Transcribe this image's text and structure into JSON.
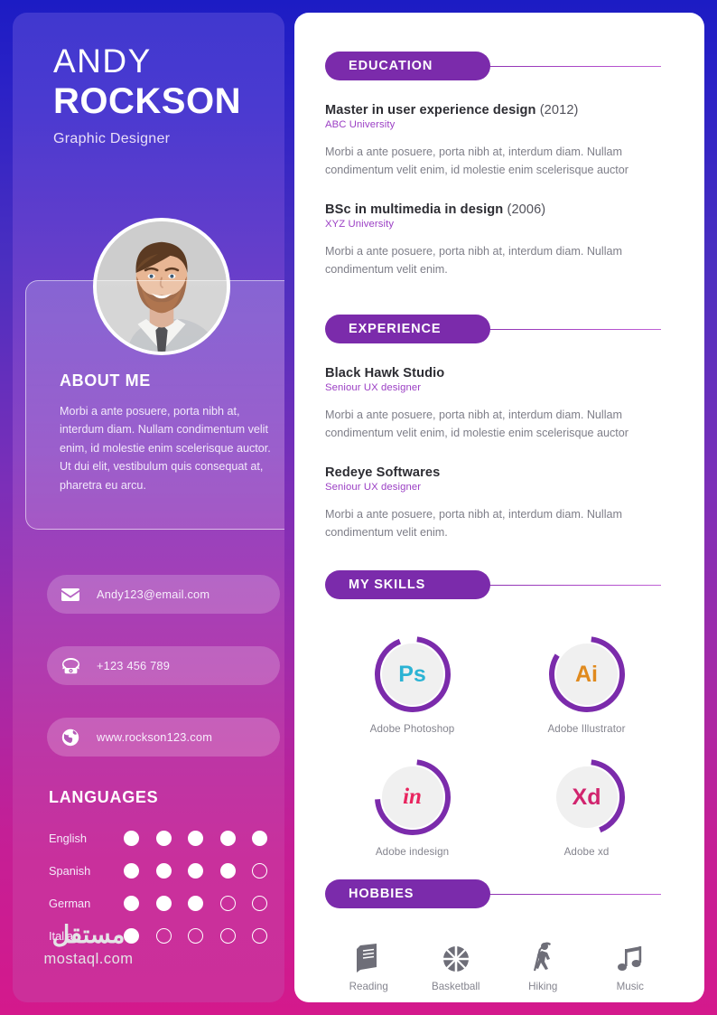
{
  "theme": {
    "page_bg_top": "#1c1cc4",
    "page_bg_bottom": "#d4198c",
    "sidebar_top": "#4038cf",
    "sidebar_bottom": "#cc2f9a",
    "pill_purple": "#7b2bab",
    "accent_link": "#9b3fc4",
    "ring_purple": "#7b2bab",
    "panel_white": "#ffffff"
  },
  "sidebar": {
    "first_name": "ANDY",
    "last_name": "ROCKSON",
    "job_title": "Graphic Designer",
    "photo": {
      "icon": "portrait-photo",
      "alt": "Portrait of a smiling bearded man in a grey suit"
    },
    "about": {
      "title": "ABOUT ME",
      "text": "Morbi a ante posuere, porta nibh at, interdum diam. Nullam condimentum velit enim, id molestie enim scelerisque auctor. Ut dui elit, vestibulum quis consequat at, pharetra eu arcu."
    },
    "contacts": [
      {
        "icon": "envelope-icon",
        "text": "Andy123@email.com"
      },
      {
        "icon": "phone-icon",
        "text": "+123 456 789"
      },
      {
        "icon": "globe-icon",
        "text": "www.rockson123.com"
      }
    ],
    "languages": {
      "title": "LANGUAGES",
      "max": 5,
      "items": [
        {
          "name": "English",
          "level": 5
        },
        {
          "name": "Spanish",
          "level": 4
        },
        {
          "name": "German",
          "level": 3
        },
        {
          "name": "Italian",
          "level": 1
        }
      ]
    }
  },
  "main": {
    "education": {
      "heading": "EDUCATION",
      "entries": [
        {
          "title": "Master in user experience design",
          "year": "(2012)",
          "sub": "ABC University",
          "desc": "Morbi a ante posuere, porta nibh at, interdum diam. Nullam condimentum velit enim, id molestie enim scelerisque auctor"
        },
        {
          "title": "BSc in multimedia in design",
          "year": "(2006)",
          "sub": "XYZ University",
          "desc": "Morbi a ante posuere, porta nibh at, interdum diam. Nullam condimentum velit enim."
        }
      ]
    },
    "experience": {
      "heading": "EXPERIENCE",
      "entries": [
        {
          "title": "Black Hawk Studio",
          "year": "",
          "sub": "Seniour UX designer",
          "desc": "Morbi a ante posuere, porta nibh at, interdum diam. Nullam condimentum velit enim, id molestie enim scelerisque auctor"
        },
        {
          "title": "Redeye Softwares",
          "year": "",
          "sub": "Seniour UX designer",
          "desc": "Morbi a ante posuere, porta nibh at, interdum diam. Nullam condimentum velit enim."
        }
      ]
    },
    "skills": {
      "heading": "MY SKILLS",
      "items": [
        {
          "abbr": "Ps",
          "label": "Adobe Photoshop",
          "color": "#2bb3d4",
          "percent": 92,
          "icon": "photoshop-ring"
        },
        {
          "abbr": "Ai",
          "label": "Adobe Illustrator",
          "color": "#e08a1e",
          "percent": 82,
          "icon": "illustrator-ring"
        },
        {
          "abbr": "in",
          "label": "Adobe indesign",
          "color": "#e8245e",
          "percent": 72,
          "icon": "indesign-ring"
        },
        {
          "abbr": "Xd",
          "label": "Adobe xd",
          "color": "#d1246e",
          "percent": 42,
          "icon": "xd-ring"
        }
      ]
    },
    "hobbies": {
      "heading": "HOBBIES",
      "items": [
        {
          "icon": "book-icon",
          "label": "Reading"
        },
        {
          "icon": "basketball-icon",
          "label": "Basketball"
        },
        {
          "icon": "hiking-icon",
          "label": "Hiking"
        },
        {
          "icon": "music-note-icon",
          "label": "Music"
        }
      ]
    }
  },
  "watermark": {
    "arabic": "مستقل",
    "latin": "mostaql.com"
  }
}
